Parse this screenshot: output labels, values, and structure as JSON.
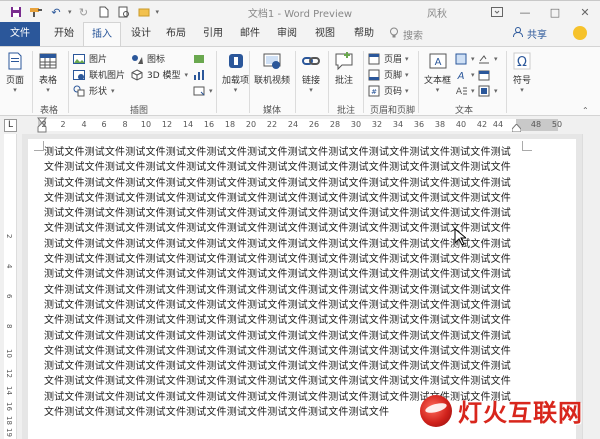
{
  "window": {
    "title": "文档1 - Word Preview",
    "user": "风秋",
    "controls": [
      "—",
      "□",
      "✕"
    ]
  },
  "tabs": {
    "file": "文件",
    "items": [
      "开始",
      "插入",
      "设计",
      "布局",
      "引用",
      "邮件",
      "审阅",
      "视图",
      "帮助"
    ],
    "active": "插入",
    "search": "搜索",
    "share": "共享"
  },
  "ribbon": {
    "pages": {
      "label": "页面",
      "group": ""
    },
    "tables": {
      "label": "表格",
      "group": "表格"
    },
    "illustrations": {
      "items": [
        "图片",
        "图标",
        "联机图片",
        "3D 模型",
        "形状"
      ],
      "group": "插图"
    },
    "addins": {
      "label": "加载项"
    },
    "media": {
      "label": "联机视频",
      "group": "媒体"
    },
    "links": {
      "label": "链接"
    },
    "comments": {
      "label": "批注",
      "group": "批注"
    },
    "header_footer": {
      "items": [
        "页眉",
        "页脚",
        "页码"
      ],
      "group": "页眉和页脚"
    },
    "text": {
      "label": "文本框",
      "group": "文本"
    },
    "symbols": {
      "label": "符号"
    }
  },
  "ruler": {
    "selector": "L",
    "ticks": [
      "2",
      "2",
      "4",
      "6",
      "8",
      "10",
      "12",
      "14",
      "16",
      "18",
      "20",
      "22",
      "24",
      "26",
      "28",
      "30",
      "32",
      "34",
      "36",
      "38",
      "40",
      "42",
      "44",
      "48",
      "50"
    ],
    "vticks": [
      "2",
      "4",
      "6",
      "8",
      "10",
      "12",
      "14",
      "16",
      "18",
      "19"
    ]
  },
  "document": {
    "body": "测试文件测试文件测试文件测试文件测试文件测试文件测试文件测试文件测试文件测试文件测试文件测试文件测试文件测试文件测试文件测试文件测试文件测试文件测试文件测试文件测试文件测试文件测试文件测试文件测试文件测试文件测试文件测试文件测试文件测试文件测试文件测试文件测试文件测试文件测试文件测试文件测试文件测试文件测试文件测试文件测试文件测试文件测试文件测试文件测试文件测试文件测试文件测试文件测试文件测试文件测试文件测试文件测试文件测试文件测试文件测试文件测试文件测试文件测试文件测试文件测试文件测试文件测试文件测试文件测试文件测试文件测试文件测试文件测试文件测试文件测试文件测试文件测试文件测试文件测试文件测试文件测试文件测试文件测试文件测试文件测试文件测试文件测试文件测试文件测试文件测试文件测试文件测试文件测试文件测试文件测试文件测试文件测试文件测试文件测试文件测试文件测试文件测试文件测试文件测试文件测试文件测试文件测试文件测试文件测试文件测试文件测试文件测试文件测试文件测试文件测试文件测试文件测试文件测试文件测试文件测试文件测试文件测试文件测试文件测试文件测试文件测试文件测试文件测试文件测试文件测试文件测试文件测试文件测试文件测试文件测试文件测试文件测试文件测试文件测试文件测试文件测试文件测试文件测试文件测试文件测试文件测试文件测试文件测试文件测试文件测试文件测试文件测试文件测试文件测试文件测试文件测试文件测试文件测试文件测试文件测试文件测试文件测试文件测试文件测试文件测试文件测试文件测试文件测试文件测试文件测试文件测试文件测试文件测试文件测试文件测试文件测试文件测试文件测试文件测试文件测试文件测试文件测试文件测试文件测试文件测试文件测试文件测试文件测试文件测试文件测试文件测试文件测试文件测试文件测试文件测试文件测试文件测试文件测试文件测试文件测试文件测试文件测试文件测试文件测试文件测试文件测试文件测试文件测试文件"
  },
  "watermark": {
    "text": "灯火互联网"
  },
  "colors": {
    "accent": "#2b579a",
    "watermark": "#d8261c"
  }
}
